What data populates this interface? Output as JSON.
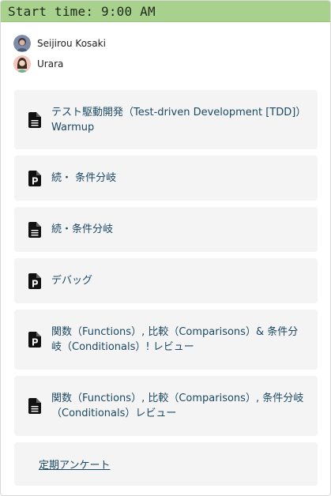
{
  "header": {
    "title": "Start time: 9:00 AM",
    "color": "#a9d18e"
  },
  "attendees": [
    {
      "name": "Seijirou Kosaki"
    },
    {
      "name": "Urara"
    }
  ],
  "items": [
    {
      "icon": "document-icon",
      "title": "テスト駆動開発（Test-driven Development [TDD]）Warmup"
    },
    {
      "icon": "document-p-icon",
      "title": "続・ 条件分岐"
    },
    {
      "icon": "document-icon",
      "title": "続・条件分岐"
    },
    {
      "icon": "document-p-icon",
      "title": "デバッグ"
    },
    {
      "icon": "document-p-icon",
      "title": "関数（Functions）, 比較（Comparisons）& 条件分岐（Conditionals）! レビュー"
    },
    {
      "icon": "document-icon",
      "title": "関数（Functions）, 比較（Comparisons）, 条件分岐（Conditionals）レビュー"
    }
  ],
  "survey": {
    "label": "定期アンケート"
  },
  "colors": {
    "link_text": "#1b4965",
    "card_background": "#f4f4f4"
  }
}
